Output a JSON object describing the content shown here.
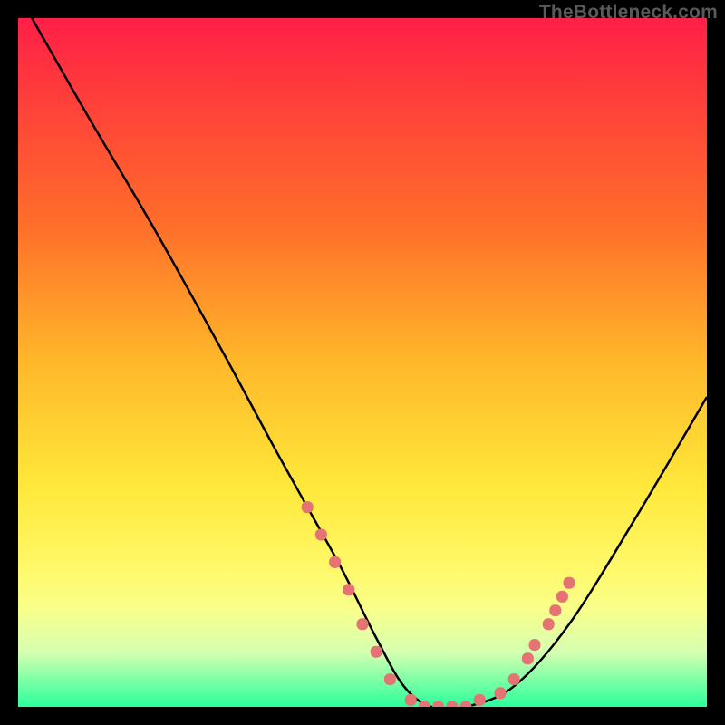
{
  "watermark": "TheBottleneck.com",
  "chart_data": {
    "type": "line",
    "title": "",
    "xlabel": "",
    "ylabel": "",
    "xlim": [
      0,
      100
    ],
    "ylim": [
      0,
      100
    ],
    "series": [
      {
        "name": "bottleneck-curve",
        "x": [
          2,
          10,
          20,
          30,
          37,
          42,
          47,
          52,
          56,
          60,
          65,
          72,
          80,
          90,
          100
        ],
        "y": [
          100,
          86,
          69,
          51,
          38,
          29,
          20,
          10,
          3,
          0,
          0,
          3,
          12,
          28,
          45
        ]
      }
    ],
    "markers": {
      "name": "highlight-dots",
      "color": "#e57373",
      "points": [
        {
          "x": 42,
          "y": 29
        },
        {
          "x": 44,
          "y": 25
        },
        {
          "x": 46,
          "y": 21
        },
        {
          "x": 48,
          "y": 17
        },
        {
          "x": 50,
          "y": 12
        },
        {
          "x": 52,
          "y": 8
        },
        {
          "x": 54,
          "y": 4
        },
        {
          "x": 57,
          "y": 1
        },
        {
          "x": 59,
          "y": 0
        },
        {
          "x": 61,
          "y": 0
        },
        {
          "x": 63,
          "y": 0
        },
        {
          "x": 65,
          "y": 0
        },
        {
          "x": 67,
          "y": 1
        },
        {
          "x": 70,
          "y": 2
        },
        {
          "x": 72,
          "y": 4
        },
        {
          "x": 74,
          "y": 7
        },
        {
          "x": 75,
          "y": 9
        },
        {
          "x": 77,
          "y": 12
        },
        {
          "x": 78,
          "y": 14
        },
        {
          "x": 79,
          "y": 16
        },
        {
          "x": 80,
          "y": 18
        }
      ]
    }
  }
}
